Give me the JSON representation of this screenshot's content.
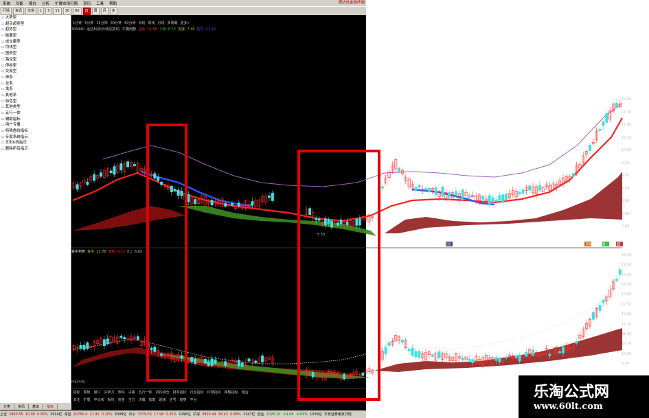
{
  "menubar": {
    "items": [
      "系统",
      "功能",
      "报价",
      "分析",
      "扩展市场行情",
      "资讯",
      "工具",
      "帮助"
    ],
    "brand": "通达信金融终端"
  },
  "toolbar": {
    "buttons": [
      {
        "label": "行情",
        "active": false
      },
      {
        "label": "资讯",
        "active": false
      },
      {
        "label": "交易",
        "active": false
      },
      {
        "label": "1",
        "active": false
      },
      {
        "label": "5",
        "active": false
      },
      {
        "label": "15",
        "active": false
      },
      {
        "label": "30",
        "active": false
      },
      {
        "label": "60",
        "active": false
      },
      {
        "label": "日",
        "active": true
      },
      {
        "label": "周",
        "active": false
      },
      {
        "label": "月",
        "active": false
      },
      {
        "label": "多",
        "active": false
      }
    ]
  },
  "sidebar": {
    "items": [
      "大势型",
      "超买超卖型",
      "趋势型",
      "能量型",
      "成交量型",
      "均线型",
      "图表型",
      "路径型",
      "停损型",
      "交易型",
      "神系",
      "龙系",
      "鬼系",
      "其他系",
      "特色型",
      "其他类型",
      "五行一体",
      "辅助指标",
      "用户专署",
      "特殊盘线指标",
      "专家系统指示",
      "五彩K线指示",
      "删除所有指示"
    ]
  },
  "period_bar": {
    "items": [
      "1分钟",
      "5分钟",
      "15分钟",
      "30分钟",
      "60分钟",
      "日线",
      "周线",
      "月线",
      "多周期",
      "更多>"
    ]
  },
  "stock": {
    "code": "300440",
    "name": "运达科技(日线前复权)",
    "indicator": "牛熊判势",
    "values": [
      {
        "label": "上轨: 11.58",
        "color": "#ff3030"
      },
      {
        "label": "下轨: 8.72",
        "color": "#40c040"
      },
      {
        "label": "支撑: 7.49",
        "color": "#c0c040"
      },
      {
        "label": "压力: 11.13",
        "color": "#4060ff"
      }
    ]
  },
  "sub_indicator": {
    "legend": [
      {
        "label": "金牛判势",
        "color": "#e0e0e0"
      },
      {
        "label": "金牛: 12.78",
        "color": "#c0c040"
      },
      {
        "label": "金轨: 9.17",
        "color": "#ff3030"
      },
      {
        "label": "8.2",
        "color": "#40c040"
      },
      {
        "label": "6.82",
        "color": "#c0c0c0"
      }
    ],
    "bottom_label": "MBI/M8J"
  },
  "main_axis": {
    "ticks": [
      "12.00",
      "11.50",
      "11.00",
      "10.50",
      "10.00",
      "9.50",
      "9.00",
      "8.50",
      "8.00",
      "7.50",
      "7.00"
    ]
  },
  "sub_axis": {
    "ticks": [
      "15.00",
      "14.50",
      "14.00",
      "13.50",
      "13.00",
      "12.50",
      "12.00",
      "11.50",
      "11.00",
      "10.50",
      "10.00",
      "9.50"
    ]
  },
  "chart_badges": [
    "BS",
    "顶背",
    "B",
    "底"
  ],
  "annotation": "5.53",
  "bottom_tabs": [
    "指标",
    "模板",
    "窗口",
    "买卖力",
    "筹码",
    "决策",
    "五行一体",
    "机构持仓",
    "财务指标",
    "行业指标",
    "红绿指标",
    "策略指标",
    "组合"
  ],
  "bottom_tabs2": [
    "关注",
    "扩展",
    "中长线",
    "板块",
    "资金",
    "主力",
    "决策",
    "指数",
    "超级",
    "信号",
    "趋势",
    "平台"
  ],
  "sheet_tabs": [
    {
      "label": "分类",
      "active": false
    },
    {
      "label": "资讯",
      "active": false
    },
    {
      "label": "基本",
      "active": false
    },
    {
      "label": "指标",
      "active": true
    }
  ],
  "statusbar": [
    {
      "text": "上证",
      "cls": ""
    },
    {
      "text": "2900.55",
      "cls": "up"
    },
    {
      "text": "10.00",
      "cls": "up"
    },
    {
      "text": "0.35%",
      "cls": "up"
    },
    {
      "text": "1914亿",
      "cls": ""
    },
    {
      "text": "深证",
      "cls": ""
    },
    {
      "text": "10750.4",
      "cls": "up"
    },
    {
      "text": "21.92",
      "cls": "up"
    },
    {
      "text": "0.20%",
      "cls": "up"
    },
    {
      "text": "3008亿",
      "cls": ""
    },
    {
      "text": "中小",
      "cls": ""
    },
    {
      "text": "7079.55",
      "cls": "up"
    },
    {
      "text": "17.98",
      "cls": "up"
    },
    {
      "text": "0.25%",
      "cls": "up"
    },
    {
      "text": "1296亿",
      "cls": ""
    },
    {
      "text": "沪深",
      "cls": ""
    },
    {
      "text": "3950.44",
      "cls": "up"
    },
    {
      "text": "34.43",
      "cls": "up"
    },
    {
      "text": "0.88%",
      "cls": "up"
    },
    {
      "text": "1347亿",
      "cls": ""
    },
    {
      "text": "创业",
      "cls": ""
    },
    {
      "text": "2028.10",
      "cls": "down"
    },
    {
      "text": "-14.08",
      "cls": "down"
    },
    {
      "text": "-0.69%",
      "cls": "down"
    },
    {
      "text": "1039亿",
      "cls": ""
    },
    {
      "text": "平安证券南京行情",
      "cls": ""
    }
  ],
  "watermark": {
    "title": "乐淘公式网",
    "url": "www.60lt.com"
  },
  "colors": {
    "up_candle": "#ff3030",
    "down_candle": "#40e0e0",
    "upper_band": "#a060c0",
    "red_line": "#ff2020",
    "blue_line": "#3050ff",
    "green_cloud": "#3c8c20",
    "red_cloud": "#8c1010",
    "highlight_box": "#e00000"
  }
}
